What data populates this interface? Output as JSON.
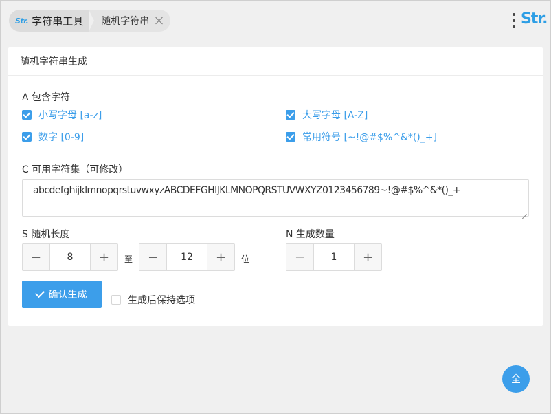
{
  "topbar": {
    "logo_small": "Str.",
    "root_label": "字符串工具",
    "tab_label": "随机字符串",
    "brand": "Str."
  },
  "card": {
    "title": "随机字符串生成",
    "section_a": "A 包含字符",
    "options": {
      "lowercase": "小写字母 [a-z]",
      "uppercase": "大写字母 [A-Z]",
      "digits": "数字 [0-9]",
      "symbols": "常用符号 [~!@#$%^&*()_+]"
    },
    "section_c": "C 可用字符集（可修改）",
    "charset": "abcdefghijklmnopqrstuvwxyzABCDEFGHIJKLMNOPQRSTUVWXYZ0123456789~!@#$%^&*()_+",
    "section_s": "S 随机长度",
    "length_min": "8",
    "to_label": "至",
    "length_max": "12",
    "unit_label": "位",
    "section_n": "N 生成数量",
    "count": "1",
    "confirm_label": "确认生成",
    "keep_options_label": "生成后保持选项"
  },
  "fab_label": "全",
  "icons": {
    "minus": "−",
    "plus": "+"
  },
  "colors": {
    "accent": "#3c9eea",
    "brand": "#2d9ee5"
  }
}
